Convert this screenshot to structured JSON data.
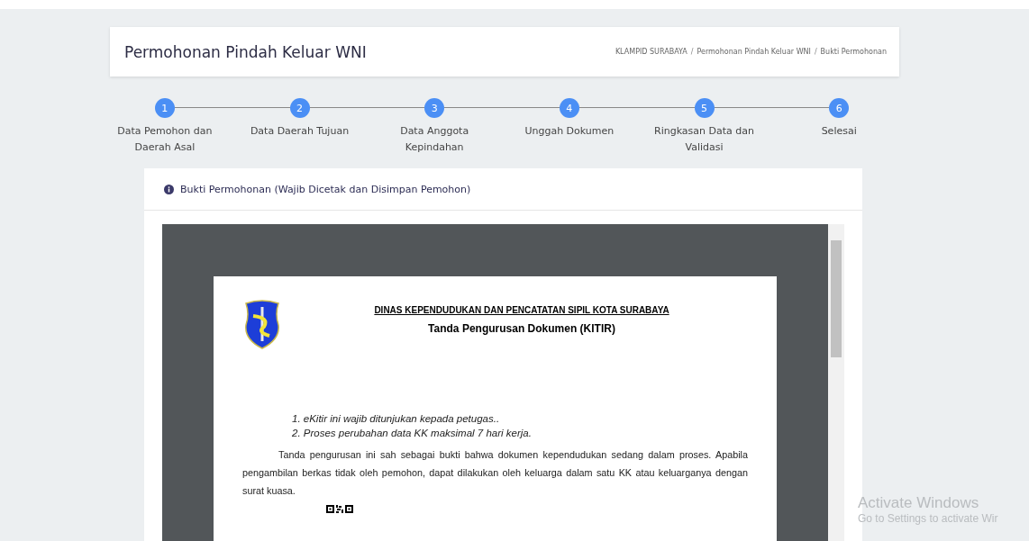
{
  "header": {
    "title": "Permohonan Pindah Keluar WNI",
    "breadcrumbs": [
      "KLAMPID SURABAYA",
      "Permohonan Pindah Keluar WNI",
      "Bukti Permohonan"
    ],
    "separator": "/"
  },
  "steps": [
    {
      "number": "1",
      "label": "Data Pemohon dan Daerah Asal"
    },
    {
      "number": "2",
      "label": "Data Daerah Tujuan"
    },
    {
      "number": "3",
      "label": "Data Anggota Kepindahan"
    },
    {
      "number": "4",
      "label": "Unggah Dokumen"
    },
    {
      "number": "5",
      "label": "Ringkasan Data dan Validasi"
    },
    {
      "number": "6",
      "label": "Selesai"
    }
  ],
  "panel": {
    "title": "Bukti Permohonan (Wajib Dicetak dan Disimpan Pemohon)"
  },
  "document": {
    "agency": "DINAS KEPENDUDUKAN DAN PENCATATAN SIPIL KOTA SURABAYA",
    "title": "Tanda Pengurusan Dokumen (KITIR)",
    "notes": [
      "1. eKitir ini wajib ditunjukan kepada petugas..",
      "2. Proses perubahan data KK maksimal 7 hari kerja."
    ],
    "paragraph": "Tanda pengurusan ini sah sebagai bukti bahwa dokumen kependudukan sedang dalam proses. Apabila pengambilan berkas tidak oleh pemohon, dapat dilakukan oleh keluarga dalam satu KK atau keluarganya dengan surat kuasa."
  },
  "activation_notice": {
    "title": "Activate Windows",
    "subtitle": "Go to Settings to activate Wir"
  }
}
